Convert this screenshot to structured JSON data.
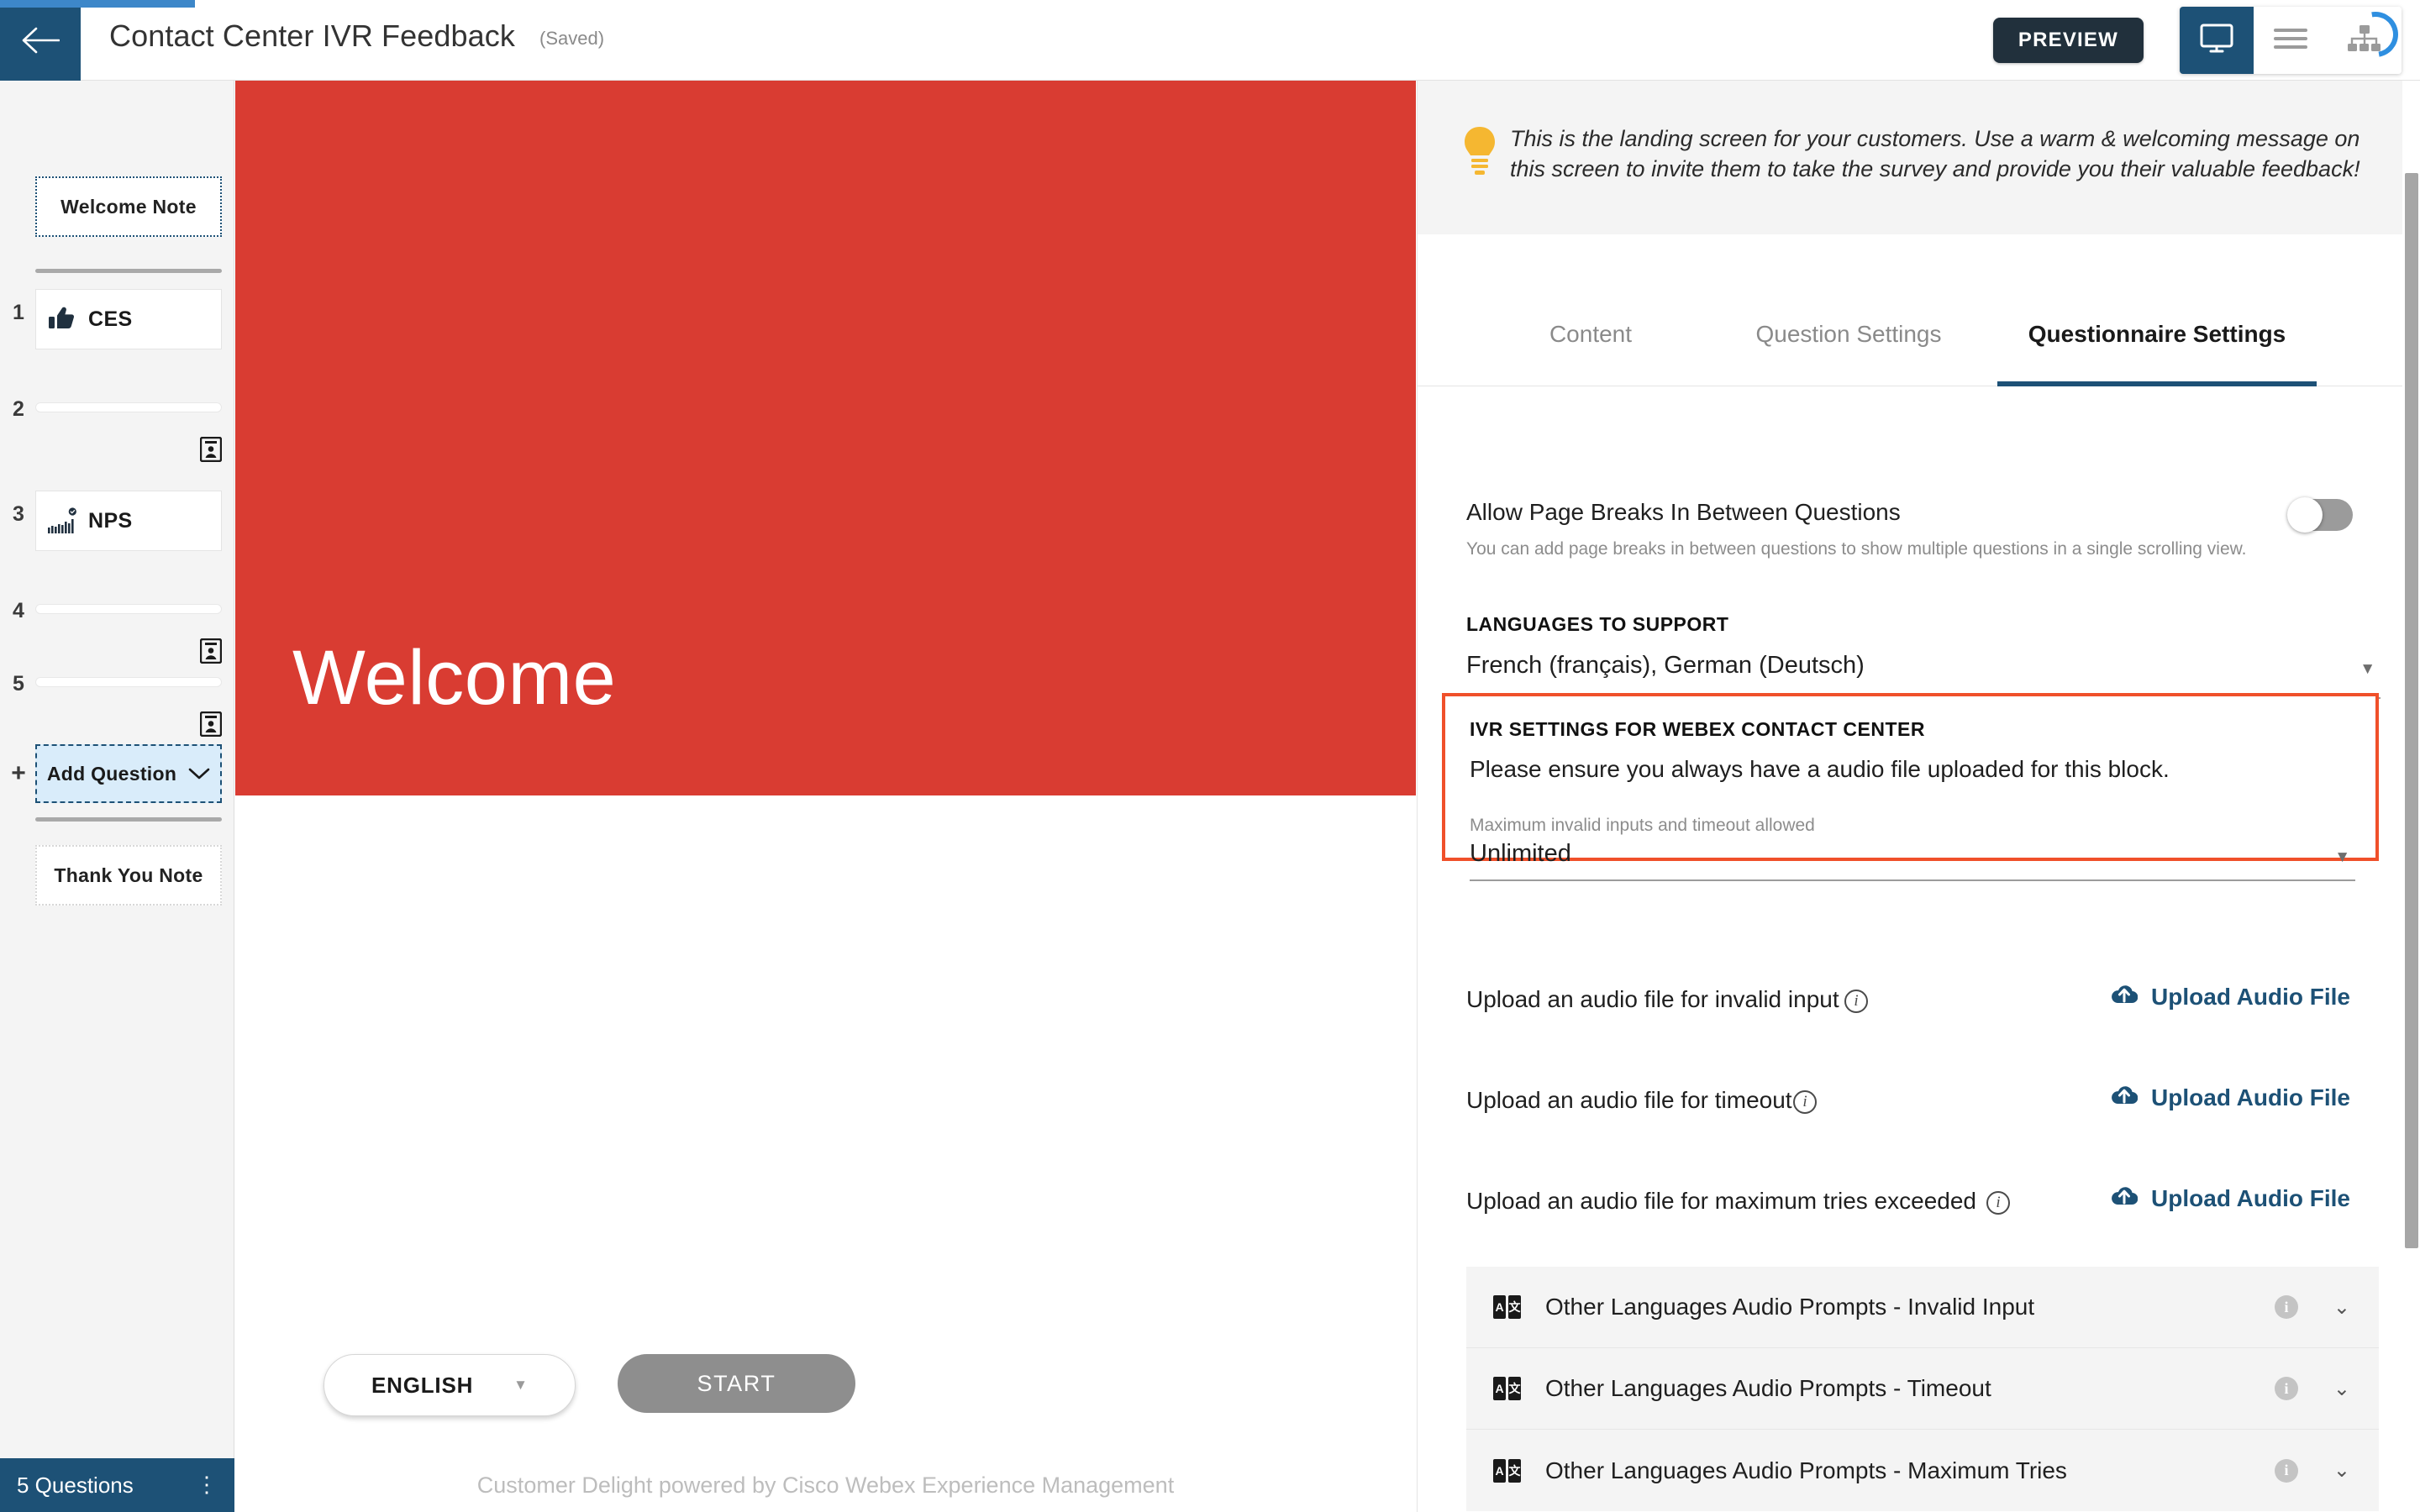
{
  "header": {
    "back_icon": "arrow-left-icon",
    "title": "Contact Center IVR Feedback",
    "saved_status": "(Saved)",
    "preview_label": "PREVIEW",
    "mode_desktop_icon": "monitor-icon",
    "mode_list_icon": "hamburger-menu-icon",
    "mode_tree_icon": "sitemap-icon",
    "spinner_icon": "loading-spinner-icon"
  },
  "sidebar": {
    "welcome_note": "Welcome Note",
    "thank_you_note": "Thank You Note",
    "add_question": "Add Question",
    "add_question_caret": "chevron-down-icon",
    "plus_symbol": "+",
    "questions": [
      {
        "number": "1",
        "label": "CES",
        "icon": "thumbs-up-icon",
        "type": "card"
      },
      {
        "number": "2",
        "label": "",
        "icon": "contact-card-icon",
        "type": "slim"
      },
      {
        "number": "3",
        "label": "NPS",
        "icon": "bar-chart-icon",
        "type": "card"
      },
      {
        "number": "4",
        "label": "",
        "icon": "contact-card-icon",
        "type": "slim"
      },
      {
        "number": "5",
        "label": "",
        "icon": "contact-card-icon",
        "type": "slim"
      }
    ],
    "status_count": "5 Questions",
    "status_kebab": "kebab-menu-icon"
  },
  "preview": {
    "hero_title": "Welcome",
    "hero_color": "#d93c32",
    "language_value": "ENGLISH",
    "language_caret": "chevron-down-icon",
    "start_label": "START",
    "footer": "Customer Delight powered by Cisco Webex Experience Management"
  },
  "panel": {
    "tip_icon": "lightbulb-icon",
    "tip_text": "This is the landing screen for your customers. Use a warm & welcoming message on this screen to invite them to take the survey and provide you their valuable feedback!",
    "tabs": [
      {
        "label": "Content",
        "active": false
      },
      {
        "label": "Question Settings",
        "active": false
      },
      {
        "label": "Questionnaire Settings",
        "active": true
      }
    ],
    "page_breaks": {
      "label": "Allow Page Breaks In Between Questions",
      "description": "You can add page breaks in between questions to show multiple questions in a single scrolling view.",
      "toggle_state": "off"
    },
    "languages": {
      "heading": "LANGUAGES TO SUPPORT",
      "value": "French (français), German (Deutsch)",
      "caret": "chevron-down-icon"
    },
    "ivr": {
      "heading": "IVR SETTINGS FOR WEBEX CONTACT CENTER",
      "notice": "Please ensure you always have a audio file uploaded for this block.",
      "field_label": "Maximum invalid inputs and timeout allowed",
      "field_value": "Unlimited",
      "caret": "chevron-down-icon",
      "highlight_color": "#f0502a"
    },
    "uploads": [
      {
        "label": "Upload an audio file for invalid input",
        "info_icon": "info-circle-icon",
        "button": "Upload Audio File",
        "button_icon": "cloud-upload-icon"
      },
      {
        "label": "Upload an audio file for timeout",
        "info_icon": "info-circle-icon",
        "button": "Upload Audio File",
        "button_icon": "cloud-upload-icon"
      },
      {
        "label": "Upload an audio file for maximum tries exceeded",
        "info_icon": "info-circle-icon",
        "button": "Upload Audio File",
        "button_icon": "cloud-upload-icon"
      }
    ],
    "accordions": [
      {
        "label": "Other Languages Audio Prompts - Invalid Input",
        "icon": "translate-icon",
        "info_icon": "info-circle-icon",
        "caret": "chevron-down-icon"
      },
      {
        "label": "Other Languages Audio Prompts - Timeout",
        "icon": "translate-icon",
        "info_icon": "info-circle-icon",
        "caret": "chevron-down-icon"
      },
      {
        "label": "Other Languages Audio Prompts - Maximum Tries",
        "icon": "translate-icon",
        "info_icon": "info-circle-icon",
        "caret": "chevron-down-icon"
      }
    ]
  },
  "colors": {
    "brand_blue": "#1d5176",
    "hero_red": "#d93c32",
    "highlight_orange": "#f0502a",
    "link_blue": "#1d5176"
  }
}
